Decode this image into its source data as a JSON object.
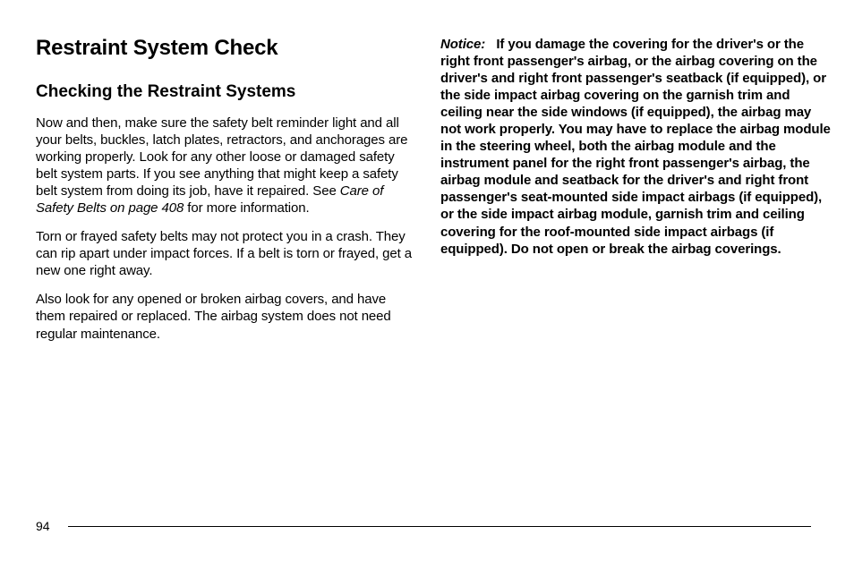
{
  "left": {
    "h1": "Restraint System Check",
    "h2": "Checking the Restraint Systems",
    "p1_a": "Now and then, make sure the safety belt reminder light and all your belts, buckles, latch plates, retractors, and anchorages are working properly. Look for any other loose or damaged safety belt system parts. If you see anything that might keep a safety belt system from doing its job, have it repaired. See ",
    "p1_italic": "Care of Safety Belts on page 408",
    "p1_b": " for more information.",
    "p2": "Torn or frayed safety belts may not protect you in a crash. They can rip apart under impact forces. If a belt is torn or frayed, get a new one right away.",
    "p3": "Also look for any opened or broken airbag covers, and have them repaired or replaced. The airbag system does not need regular maintenance."
  },
  "right": {
    "notice_label": "Notice:",
    "notice_spacer": "   ",
    "notice_body": "If you damage the covering for the driver's or the right front passenger's airbag, or the airbag covering on the driver's and right front passenger's seatback (if equipped), or the side impact airbag covering on the garnish trim and ceiling near the side windows (if equipped), the airbag may not work properly. You may have to replace the airbag module in the steering wheel, both the airbag module and the instrument panel for the right front passenger's airbag, the airbag module and seatback for the driver's and right front passenger's seat-mounted side impact airbags (if equipped), or the side impact airbag module, garnish trim and ceiling covering for the roof-mounted side impact airbags (if equipped). Do not open or break the airbag coverings."
  },
  "page_number": "94"
}
